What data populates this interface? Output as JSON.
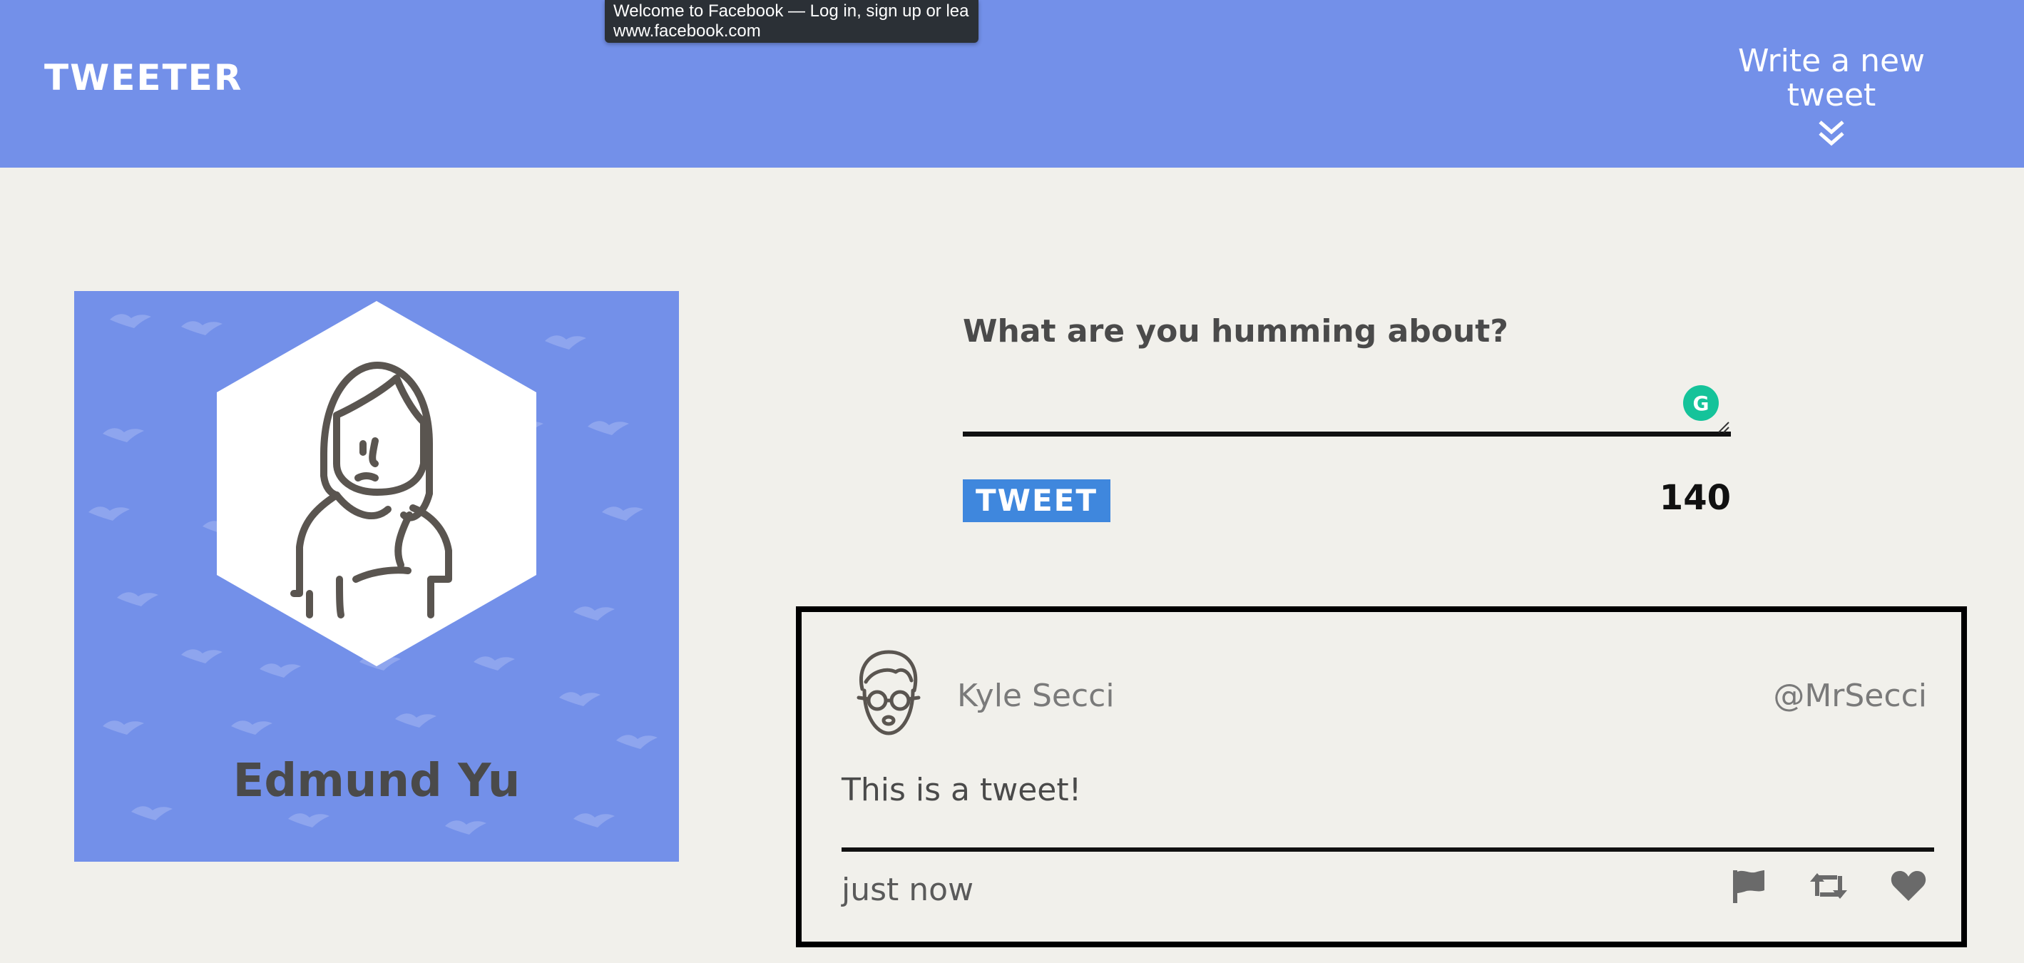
{
  "nav": {
    "brand": "TWEETER",
    "compose_toggle_label": "Write a new tweet",
    "compose_toggle_icon": "double-chevron-down-icon"
  },
  "tooltip": {
    "title": "Welcome to Facebook — Log in, sign up or lea...",
    "url": "www.facebook.com"
  },
  "profile": {
    "name": "Edmund Yu",
    "avatar_icon": "user-avatar-icon",
    "background_pattern_icon": "bird-pattern-icon"
  },
  "composer": {
    "prompt": "What are you humming about?",
    "textarea_value": "",
    "button_label": "TWEET",
    "counter": "140",
    "grammarly_icon": "grammarly-icon",
    "grammarly_glyph": "G"
  },
  "tweets": [
    {
      "author": "Kyle Secci",
      "handle": "@MrSecci",
      "content": "This is a tweet!",
      "time": "just now",
      "avatar_icon": "user-with-glasses-icon",
      "actions": [
        "flag-icon",
        "retweet-icon",
        "heart-icon"
      ]
    }
  ],
  "colors": {
    "nav_bg": "#7390e9",
    "page_bg": "#f1f0eb",
    "tweet_button": "#3f87dd",
    "text_dark": "#4a4a4a",
    "grammarly": "#15c39a"
  }
}
